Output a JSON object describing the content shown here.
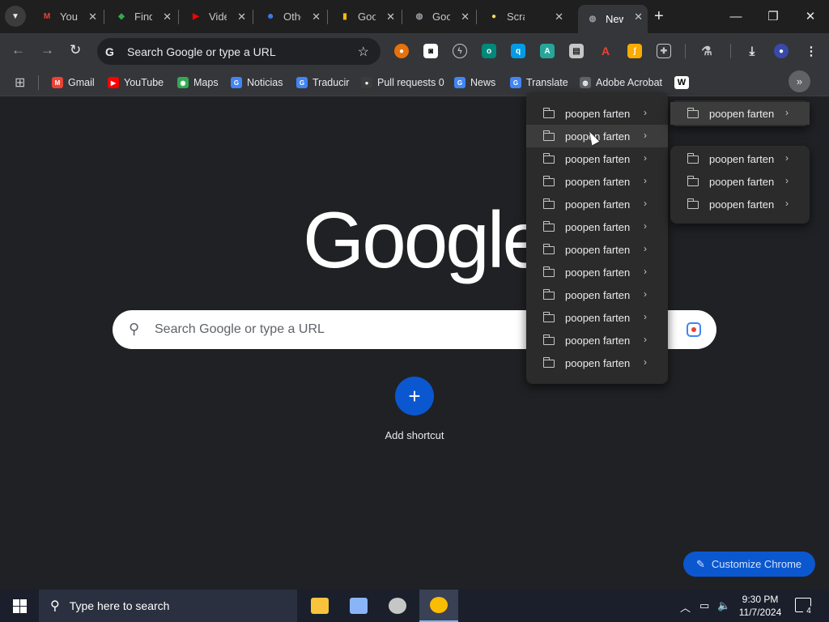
{
  "tabs": [
    {
      "title": "YouTube",
      "favicon": "gmail-icon",
      "color": "#ea4335",
      "letter": "M"
    },
    {
      "title": "Find",
      "favicon": "drive-icon",
      "color": "#34a853",
      "letter": "◆"
    },
    {
      "title": "Video",
      "favicon": "youtube-icon",
      "color": "#ff0000",
      "letter": "▶"
    },
    {
      "title": "Other",
      "favicon": "people-icon",
      "color": "#4285f4",
      "letter": "☻"
    },
    {
      "title": "Google",
      "favicon": "keep-icon",
      "color": "#fbbc04",
      "letter": "▮"
    },
    {
      "title": "Google",
      "favicon": "globe-icon",
      "color": "#9aa0a6",
      "letter": "◍"
    },
    {
      "title": "Scratch",
      "favicon": "coin-icon",
      "color": "#fdd663",
      "letter": "●"
    },
    {
      "title": "New Tab",
      "favicon": "chrome-icon",
      "color": "#9aa0a6",
      "letter": "◍"
    }
  ],
  "omnibox": {
    "placeholder": "Search Google or type a URL"
  },
  "bookmarks": [
    {
      "label": "Gmail",
      "icon": "gmail-icon",
      "color": "#ea4335",
      "letter": "M"
    },
    {
      "label": "YouTube",
      "icon": "youtube-icon",
      "color": "#ff0000",
      "letter": "▶"
    },
    {
      "label": "Maps",
      "icon": "maps-icon",
      "color": "#34a853",
      "letter": "◉"
    },
    {
      "label": "Noticias",
      "icon": "news-icon",
      "color": "#4285f4",
      "letter": "G"
    },
    {
      "label": "Traducir",
      "icon": "translate-icon",
      "color": "#4285f4",
      "letter": "G"
    },
    {
      "label": "Pull requests 0",
      "icon": "github-icon",
      "color": "#3c3c3c",
      "letter": "●"
    },
    {
      "label": "News",
      "icon": "news-icon",
      "color": "#4285f4",
      "letter": "G"
    },
    {
      "label": "Translate",
      "icon": "translate-icon",
      "color": "#4285f4",
      "letter": "G"
    },
    {
      "label": "Adobe Acrobat",
      "icon": "globe-icon",
      "color": "#5f6368",
      "letter": "◍"
    },
    {
      "label": "",
      "icon": "wikipedia-icon",
      "color": "#ffffff",
      "letter": "W"
    }
  ],
  "ntp": {
    "logo": "Google",
    "search_placeholder": "Search Google or type a URL",
    "add_shortcut": "Add shortcut",
    "customize": "Customize Chrome"
  },
  "menu_primary": [
    "poopen farten",
    "poopen farten",
    "poopen farten",
    "poopen farten",
    "poopen farten",
    "poopen farten",
    "poopen farten",
    "poopen farten",
    "poopen farten",
    "poopen farten",
    "poopen farten",
    "poopen farten"
  ],
  "menu_top": [
    "poopen farten"
  ],
  "menu_sub": [
    "poopen farten",
    "poopen farten",
    "poopen farten"
  ],
  "taskbar": {
    "search_placeholder": "Type here to search",
    "time": "9:30 PM",
    "date": "11/7/2024",
    "notification_count": "4"
  }
}
